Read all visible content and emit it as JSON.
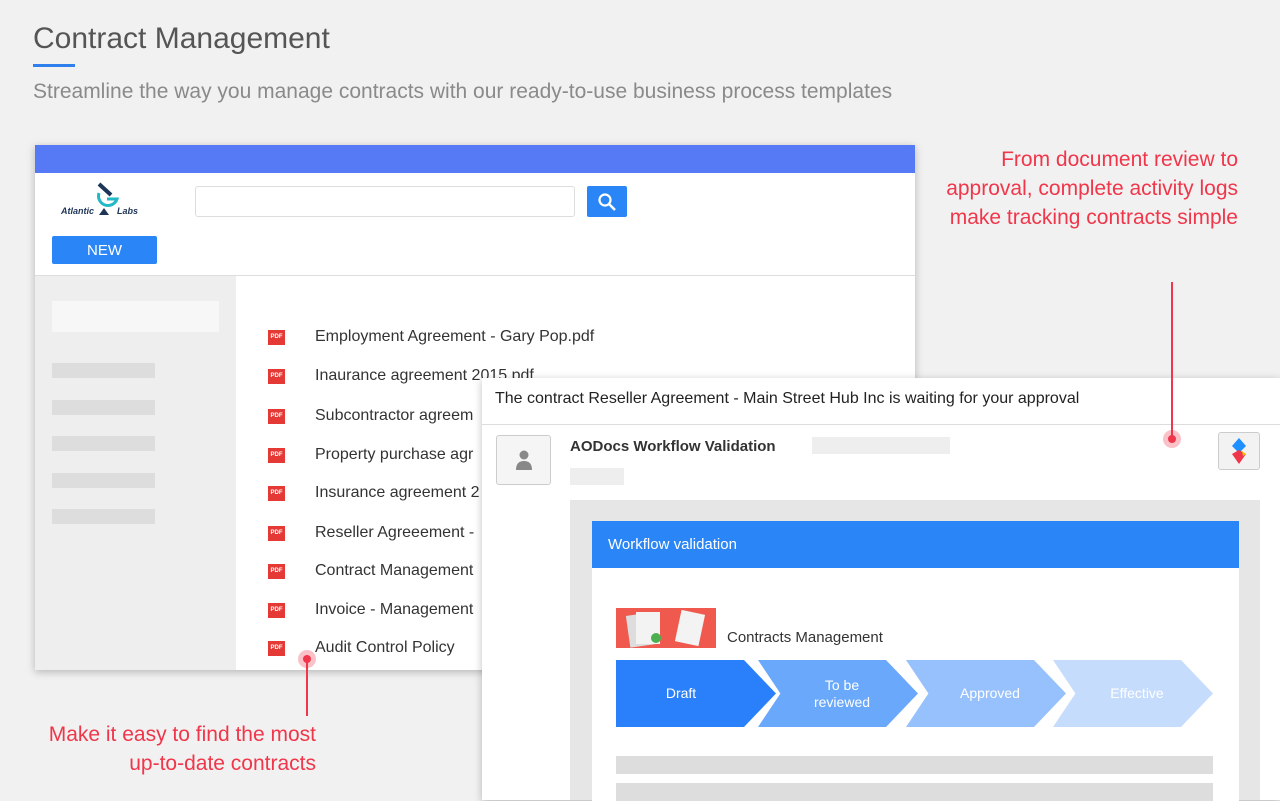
{
  "header": {
    "title": "Contract Management",
    "subtitle": "Streamline the way you manage contracts with our ready-to-use business process templates"
  },
  "app": {
    "logo_text": "Atlantic Labs",
    "search_placeholder": "",
    "new_label": "NEW",
    "files": [
      "Employment Agreement - Gary Pop.pdf",
      "Inaurance agreement 2015.pdf",
      "Subcontractor agreem",
      "Property purchase agr",
      "Insurance agreement 2",
      "Reseller Agreeement -",
      "Contract Management",
      "Invoice - Management",
      "Audit Control Policy"
    ],
    "file_badge": "PDF"
  },
  "email": {
    "subject": "The contract Reseller Agreement - Main Street Hub Inc is waiting for your approval",
    "sender": "AODocs Workflow Validation",
    "card_title": "Workflow validation",
    "workflow_name": "Contracts Management",
    "steps": [
      {
        "label": "Draft",
        "color": "#2a80fb"
      },
      {
        "label": "To be reviewed",
        "color": "#6aa8fb"
      },
      {
        "label": "Approved",
        "color": "#97c1fc"
      },
      {
        "label": "Effective",
        "color": "#c5dcfd"
      }
    ],
    "current_step": "Draft"
  },
  "notes": {
    "right": "From document review to approval, complete activity logs make tracking contracts simple",
    "left": "Make it easy to find the most up-to-date contracts"
  },
  "colors": {
    "accent": "#2a86f7",
    "annotation": "#f0364a",
    "topbar": "#5679f5"
  }
}
